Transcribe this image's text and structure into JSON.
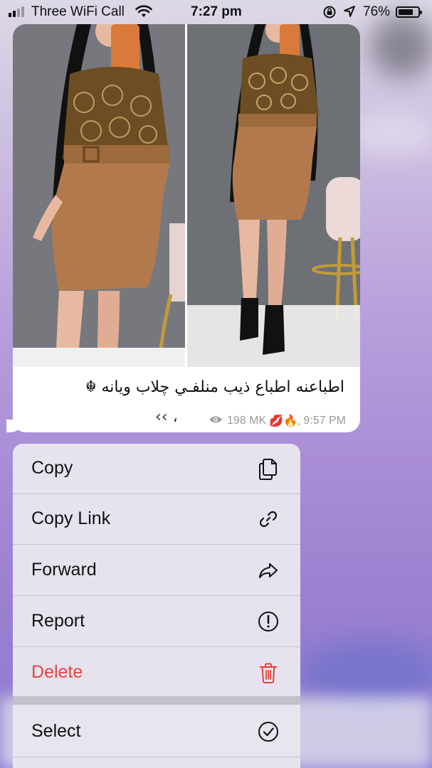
{
  "status_bar": {
    "carrier": "Three WiFi Call",
    "time": "7:27 pm",
    "battery_percent": "76%",
    "battery_level": 0.76
  },
  "message": {
    "caption": "اطباعنه اطباع ذيب منلفـي چلاب ويانه ☬",
    "views": "198 MK",
    "time": "9:57 PM",
    "emoji": "💋🔥,",
    "hook": "‹‹ ،",
    "colors": {
      "dress": "#b27a4c",
      "lace": "#7a5a2c",
      "wall": "#6d7075"
    }
  },
  "context_menu": {
    "items": [
      {
        "label": "Copy",
        "icon": "copy-icon"
      },
      {
        "label": "Copy Link",
        "icon": "link-icon"
      },
      {
        "label": "Forward",
        "icon": "forward-icon"
      },
      {
        "label": "Report",
        "icon": "report-icon"
      },
      {
        "label": "Delete",
        "icon": "trash-icon",
        "color": "#e5453c"
      },
      {
        "label": "Select",
        "icon": "checkmark-circle-icon"
      }
    ]
  }
}
